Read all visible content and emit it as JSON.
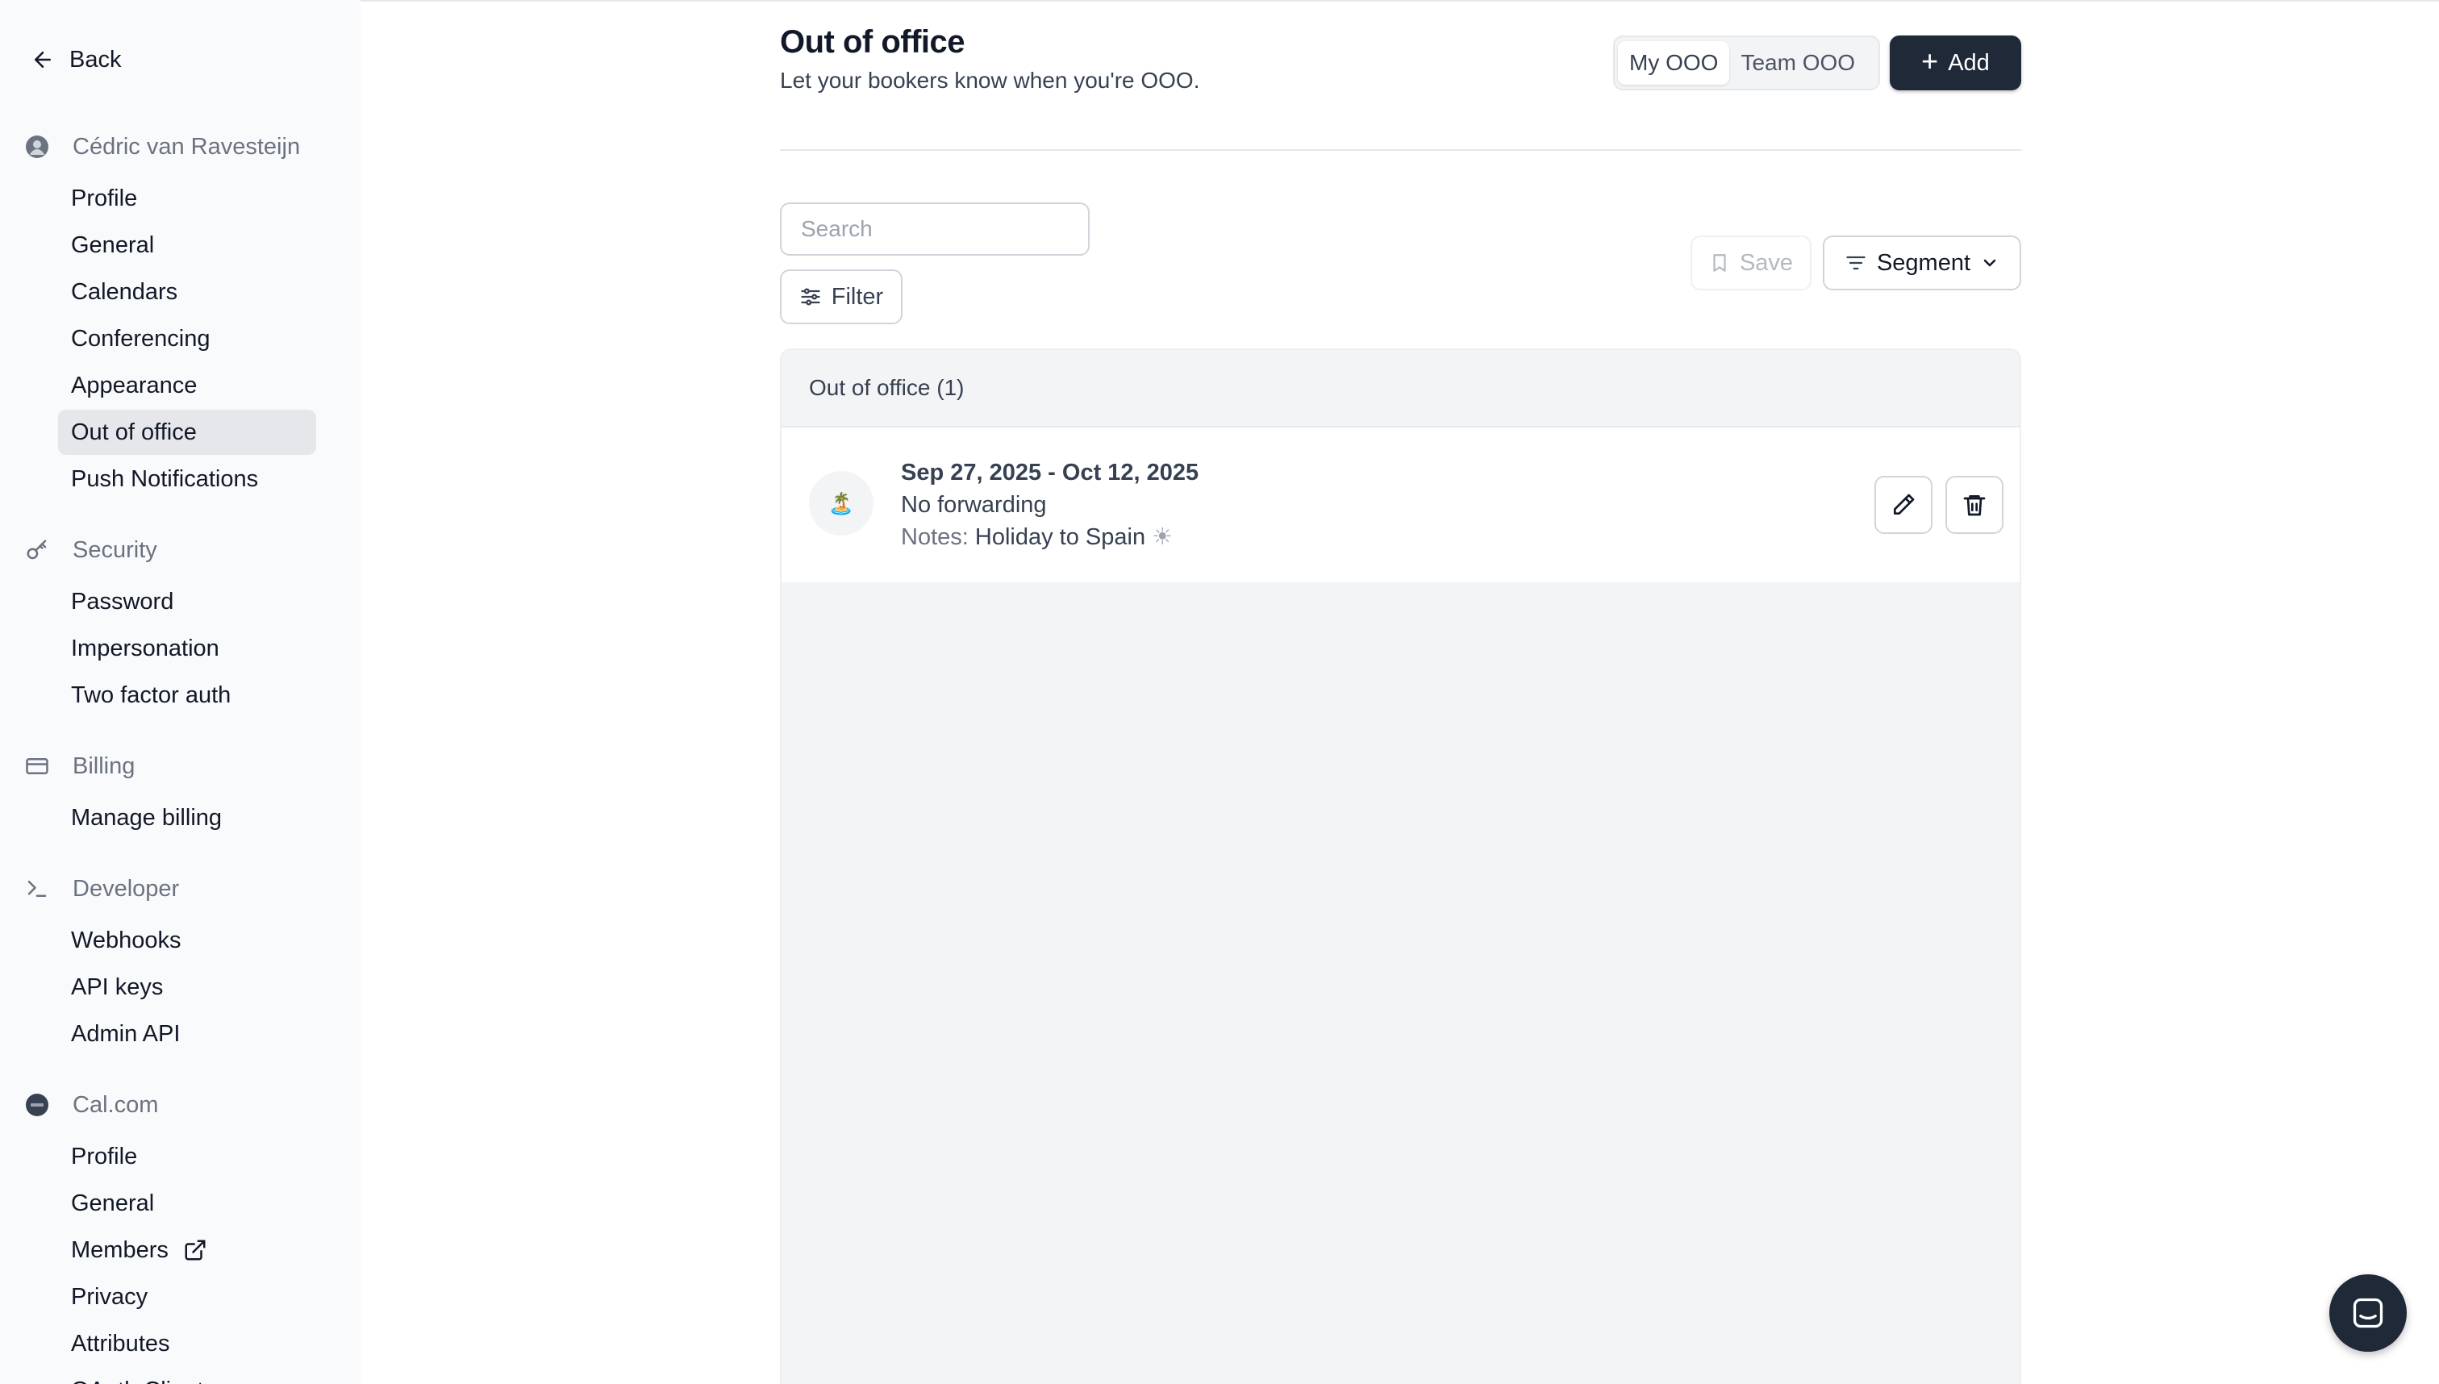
{
  "sidebar": {
    "back_label": "Back",
    "groups": [
      {
        "title": "Cédric van Ravesteijn",
        "icon": "avatar",
        "items": [
          {
            "label": "Profile"
          },
          {
            "label": "General"
          },
          {
            "label": "Calendars"
          },
          {
            "label": "Conferencing"
          },
          {
            "label": "Appearance"
          },
          {
            "label": "Out of office",
            "active": true
          },
          {
            "label": "Push Notifications"
          }
        ]
      },
      {
        "title": "Security",
        "icon": "key-icon",
        "items": [
          {
            "label": "Password"
          },
          {
            "label": "Impersonation"
          },
          {
            "label": "Two factor auth"
          }
        ]
      },
      {
        "title": "Billing",
        "icon": "credit-card-icon",
        "items": [
          {
            "label": "Manage billing"
          }
        ]
      },
      {
        "title": "Developer",
        "icon": "terminal-icon",
        "items": [
          {
            "label": "Webhooks"
          },
          {
            "label": "API keys"
          },
          {
            "label": "Admin API"
          }
        ]
      },
      {
        "title": "Cal.com",
        "icon": "org-logo",
        "items": [
          {
            "label": "Profile"
          },
          {
            "label": "General"
          },
          {
            "label": "Members",
            "external": true
          },
          {
            "label": "Privacy"
          },
          {
            "label": "Attributes"
          },
          {
            "label": "OAuth Clients"
          }
        ]
      }
    ]
  },
  "header": {
    "title": "Out of office",
    "subtitle": "Let your bookers know when you're OOO.",
    "toggle": {
      "options": [
        "My OOO",
        "Team OOO"
      ],
      "selected": "My OOO"
    },
    "add_label": "Add"
  },
  "toolbar": {
    "search_placeholder": "Search",
    "filter_label": "Filter",
    "save_label": "Save",
    "segment_label": "Segment"
  },
  "table": {
    "header": "Out of office (1)",
    "entries": [
      {
        "dates": "Sep 27, 2025 - Oct 12, 2025",
        "forwarding": "No forwarding",
        "notes_label": "Notes:",
        "notes": "Holiday to Spain",
        "emoji": "🏝️"
      }
    ]
  },
  "colors": {
    "primary_button": "#1f2937",
    "sidebar_bg": "#f9fafb",
    "active_item_bg": "#e5e7eb"
  }
}
